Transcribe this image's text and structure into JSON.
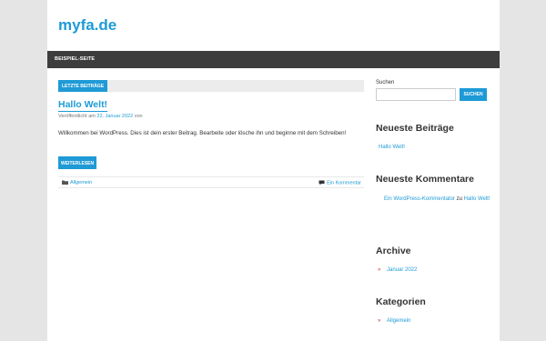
{
  "site": {
    "title": "myfa.de"
  },
  "nav": {
    "items": [
      {
        "label": "BEISPIEL-SEITE"
      }
    ]
  },
  "main": {
    "section_label": "LETZTE BEITRÄGE",
    "post": {
      "title": "Hallo Welt!",
      "meta_prefix": "Veröffentlicht am",
      "meta_date": "22. Januar 2022",
      "meta_suffix": "von",
      "excerpt": "Willkommen bei WordPress. Dies ist dein erster Beitrag. Bearbeite oder lösche ihn und beginne mit dem Schreiben!",
      "readmore_label": "WEITERLESEN",
      "category": "Allgemein",
      "comments_label": "Ein Kommentar"
    }
  },
  "sidebar": {
    "search": {
      "label": "Suchen",
      "placeholder": "",
      "button_label": "SUCHEN"
    },
    "recent_posts": {
      "title": "Neueste Beiträge",
      "items": [
        "Hallo Welt!"
      ]
    },
    "recent_comments": {
      "title": "Neueste Kommentare",
      "author": "Ein WordPress-Kommentator",
      "connector": "zu",
      "post": "Hallo Welt!"
    },
    "archive": {
      "title": "Archive",
      "items": [
        "Januar 2022"
      ]
    },
    "categories": {
      "title": "Kategorien",
      "items": [
        "Allgemein"
      ]
    }
  },
  "colors": {
    "accent": "#1e9ad6",
    "navbar": "#3d3d3d",
    "background": "#e5e5e5",
    "bullet": "#cc3333"
  },
  "icons": {
    "category": "folder-icon",
    "comments": "comment-icon"
  }
}
